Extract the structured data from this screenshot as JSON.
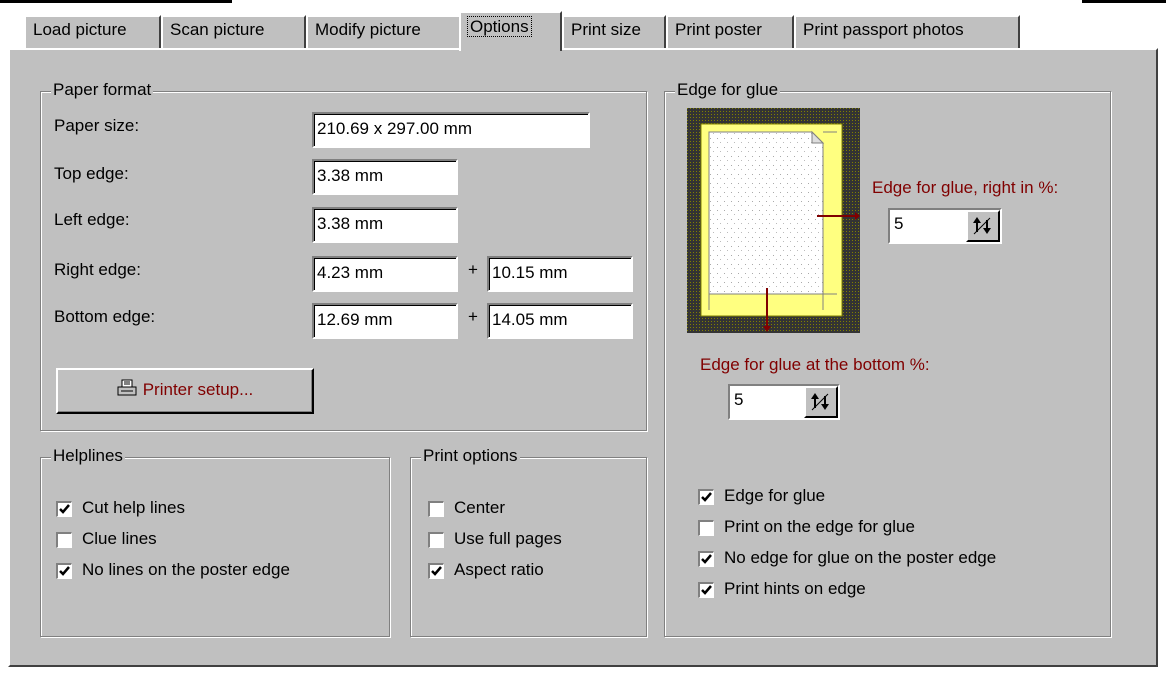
{
  "tabs": [
    "Load picture",
    "Scan picture",
    "Modify picture",
    "Options",
    "Print size",
    "Print poster",
    "Print passport photos"
  ],
  "paper_format": {
    "title": "Paper format",
    "paper_size_label": "Paper size:",
    "paper_size_value": "210.69 x 297.00 mm",
    "top_edge_label": "Top edge:",
    "top_edge_value": "3.38 mm",
    "left_edge_label": "Left edge:",
    "left_edge_value": "3.38 mm",
    "right_edge_label": "Right edge:",
    "right_edge_value": "4.23 mm",
    "right_edge_extra": "10.15 mm",
    "bottom_edge_label": "Bottom edge:",
    "bottom_edge_value": "12.69 mm",
    "bottom_edge_extra": "14.05 mm",
    "plus": "+",
    "printer_setup_label": "Printer setup..."
  },
  "helplines": {
    "title": "Helplines",
    "items": [
      {
        "label": "Cut help lines",
        "checked": true
      },
      {
        "label": "Clue lines",
        "checked": false
      },
      {
        "label": "No lines on the poster edge",
        "checked": true
      }
    ]
  },
  "print_options": {
    "title": "Print options",
    "items": [
      {
        "label": "Center",
        "checked": false
      },
      {
        "label": "Use full pages",
        "checked": false
      },
      {
        "label": "Aspect ratio",
        "checked": true
      }
    ]
  },
  "edge_for_glue": {
    "title": "Edge for glue",
    "right_label": "Edge for glue, right in %:",
    "right_value": "5",
    "bottom_label": "Edge for glue at the bottom %:",
    "bottom_value": "5",
    "items": [
      {
        "label": "Edge for glue",
        "checked": true
      },
      {
        "label": "Print on the edge for glue",
        "checked": false
      },
      {
        "label": "No edge for glue on the poster edge",
        "checked": true
      },
      {
        "label": "Print hints on edge",
        "checked": true
      }
    ]
  }
}
